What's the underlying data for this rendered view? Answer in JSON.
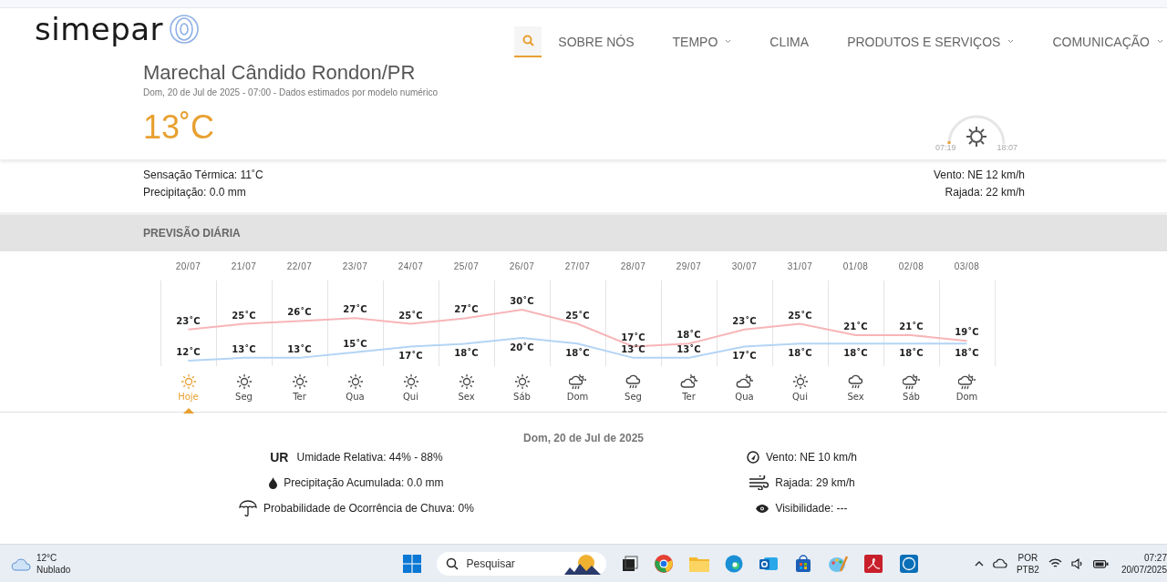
{
  "header": {
    "logo": "simepar",
    "nav": [
      {
        "label": "SOBRE NÓS",
        "dropdown": false
      },
      {
        "label": "TEMPO",
        "dropdown": true
      },
      {
        "label": "CLIMA",
        "dropdown": false
      },
      {
        "label": "PRODUTOS E SERVIÇOS",
        "dropdown": true
      },
      {
        "label": "COMUNICAÇÃO",
        "dropdown": true
      }
    ]
  },
  "current": {
    "city": "Marechal Cândido Rondon/PR",
    "subtitle": "Dom, 20 de Jul de 2025 - 07:00 - Dados estimados por modelo numérico",
    "temperature": "13˚C",
    "sunrise": "07:19",
    "sunset": "18:07",
    "daylight": {
      "level": 0.03
    },
    "details_left": [
      "Sensação Térmica: 11˚C",
      "Precipitação: 0.0 mm"
    ],
    "details_right": [
      "Vento: NE 12 km/h",
      "Rajada: 22 km/h"
    ]
  },
  "forecast": {
    "title": "PREVISÃO DIÁRIA",
    "chart_data": {
      "type": "line",
      "categories": [
        "20/07",
        "21/07",
        "22/07",
        "23/07",
        "24/07",
        "25/07",
        "26/07",
        "27/07",
        "28/07",
        "29/07",
        "30/07",
        "31/07",
        "01/08",
        "02/08",
        "03/08"
      ],
      "data_labels": true,
      "series": [
        {
          "color": "#f7b5b8",
          "values": [
            23,
            25,
            26,
            27,
            25,
            27,
            30,
            25,
            17,
            18,
            23,
            25,
            21,
            21,
            19
          ],
          "value_labels": [
            "23˚C",
            "25˚C",
            "26˚C",
            "27˚C",
            "25˚C",
            "27˚C",
            "30˚C",
            "25˚C",
            "17˚C",
            "18˚C",
            "23˚C",
            "25˚C",
            "21˚C",
            "21˚C",
            "19˚C"
          ]
        },
        {
          "color": "#b3d4f5",
          "values": [
            12,
            13,
            13,
            15,
            17,
            18,
            20,
            18,
            13,
            13,
            17,
            18,
            18,
            18,
            18
          ],
          "value_labels": [
            "12˚C",
            "13˚C",
            "13˚C",
            "15˚C",
            "17˚C",
            "18˚C",
            "20˚C",
            "18˚C",
            "13˚C",
            "13˚C",
            "17˚C",
            "18˚C",
            "18˚C",
            "18˚C",
            "18˚C"
          ]
        }
      ]
    },
    "days": [
      {
        "weekday": "Hoje",
        "kind": "sun",
        "selected": true
      },
      {
        "weekday": "Seg",
        "kind": "sun",
        "selected": false
      },
      {
        "weekday": "Ter",
        "kind": "sun",
        "selected": false
      },
      {
        "weekday": "Qua",
        "kind": "sun",
        "selected": false
      },
      {
        "weekday": "Qui",
        "kind": "sun",
        "selected": false
      },
      {
        "weekday": "Sex",
        "kind": "sun",
        "selected": false
      },
      {
        "weekday": "Sáb",
        "kind": "sun",
        "selected": false
      },
      {
        "weekday": "Dom",
        "kind": "sunrain",
        "selected": false
      },
      {
        "weekday": "Seg",
        "kind": "rain",
        "selected": false
      },
      {
        "weekday": "Ter",
        "kind": "cloudsun",
        "selected": false
      },
      {
        "weekday": "Qua",
        "kind": "cloudsun",
        "selected": false
      },
      {
        "weekday": "Qui",
        "kind": "sun",
        "selected": false
      },
      {
        "weekday": "Sex",
        "kind": "rain",
        "selected": false
      },
      {
        "weekday": "Sáb",
        "kind": "sunrain",
        "selected": false
      },
      {
        "weekday": "Dom",
        "kind": "sunrain",
        "selected": false
      }
    ]
  },
  "day_detail": {
    "title": "Dom, 20 de Jul de 2025",
    "left": [
      {
        "kind": "humidity",
        "badge": "UR",
        "text": "Umidade Relativa: 44% - 88%"
      },
      {
        "kind": "drop",
        "text": "Precipitação Acumulada: 0.0 mm"
      },
      {
        "kind": "umbrella",
        "text": "Probabilidade de Ocorrência de Chuva: 0%"
      }
    ],
    "right": [
      {
        "kind": "gauge",
        "text": "Vento: NE 10 km/h"
      },
      {
        "kind": "wind",
        "text": "Rajada: 29 km/h"
      },
      {
        "kind": "eye",
        "text": "Visibilidade: ---"
      }
    ]
  },
  "taskbar": {
    "weather_temp": "12°C",
    "weather_text": "Nublado",
    "search": "Pesquisar",
    "language": "POR",
    "layout": "PTB2",
    "time": "07:27",
    "date": "20/07/2025"
  }
}
